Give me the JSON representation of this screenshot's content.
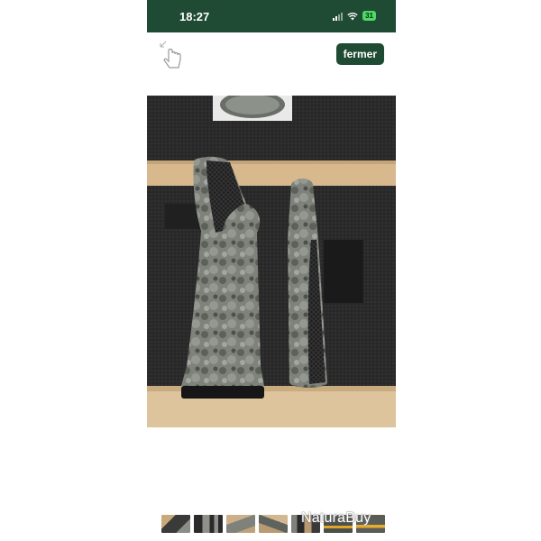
{
  "status_bar": {
    "time": "18:27",
    "battery": "31",
    "bar_color": "#1f4a33"
  },
  "toolbar": {
    "gesture_icon": "hand-swipe-icon",
    "close_label": "fermer"
  },
  "gallery": {
    "thumbnail_count": 7,
    "watermark": "NaturaBuy"
  }
}
